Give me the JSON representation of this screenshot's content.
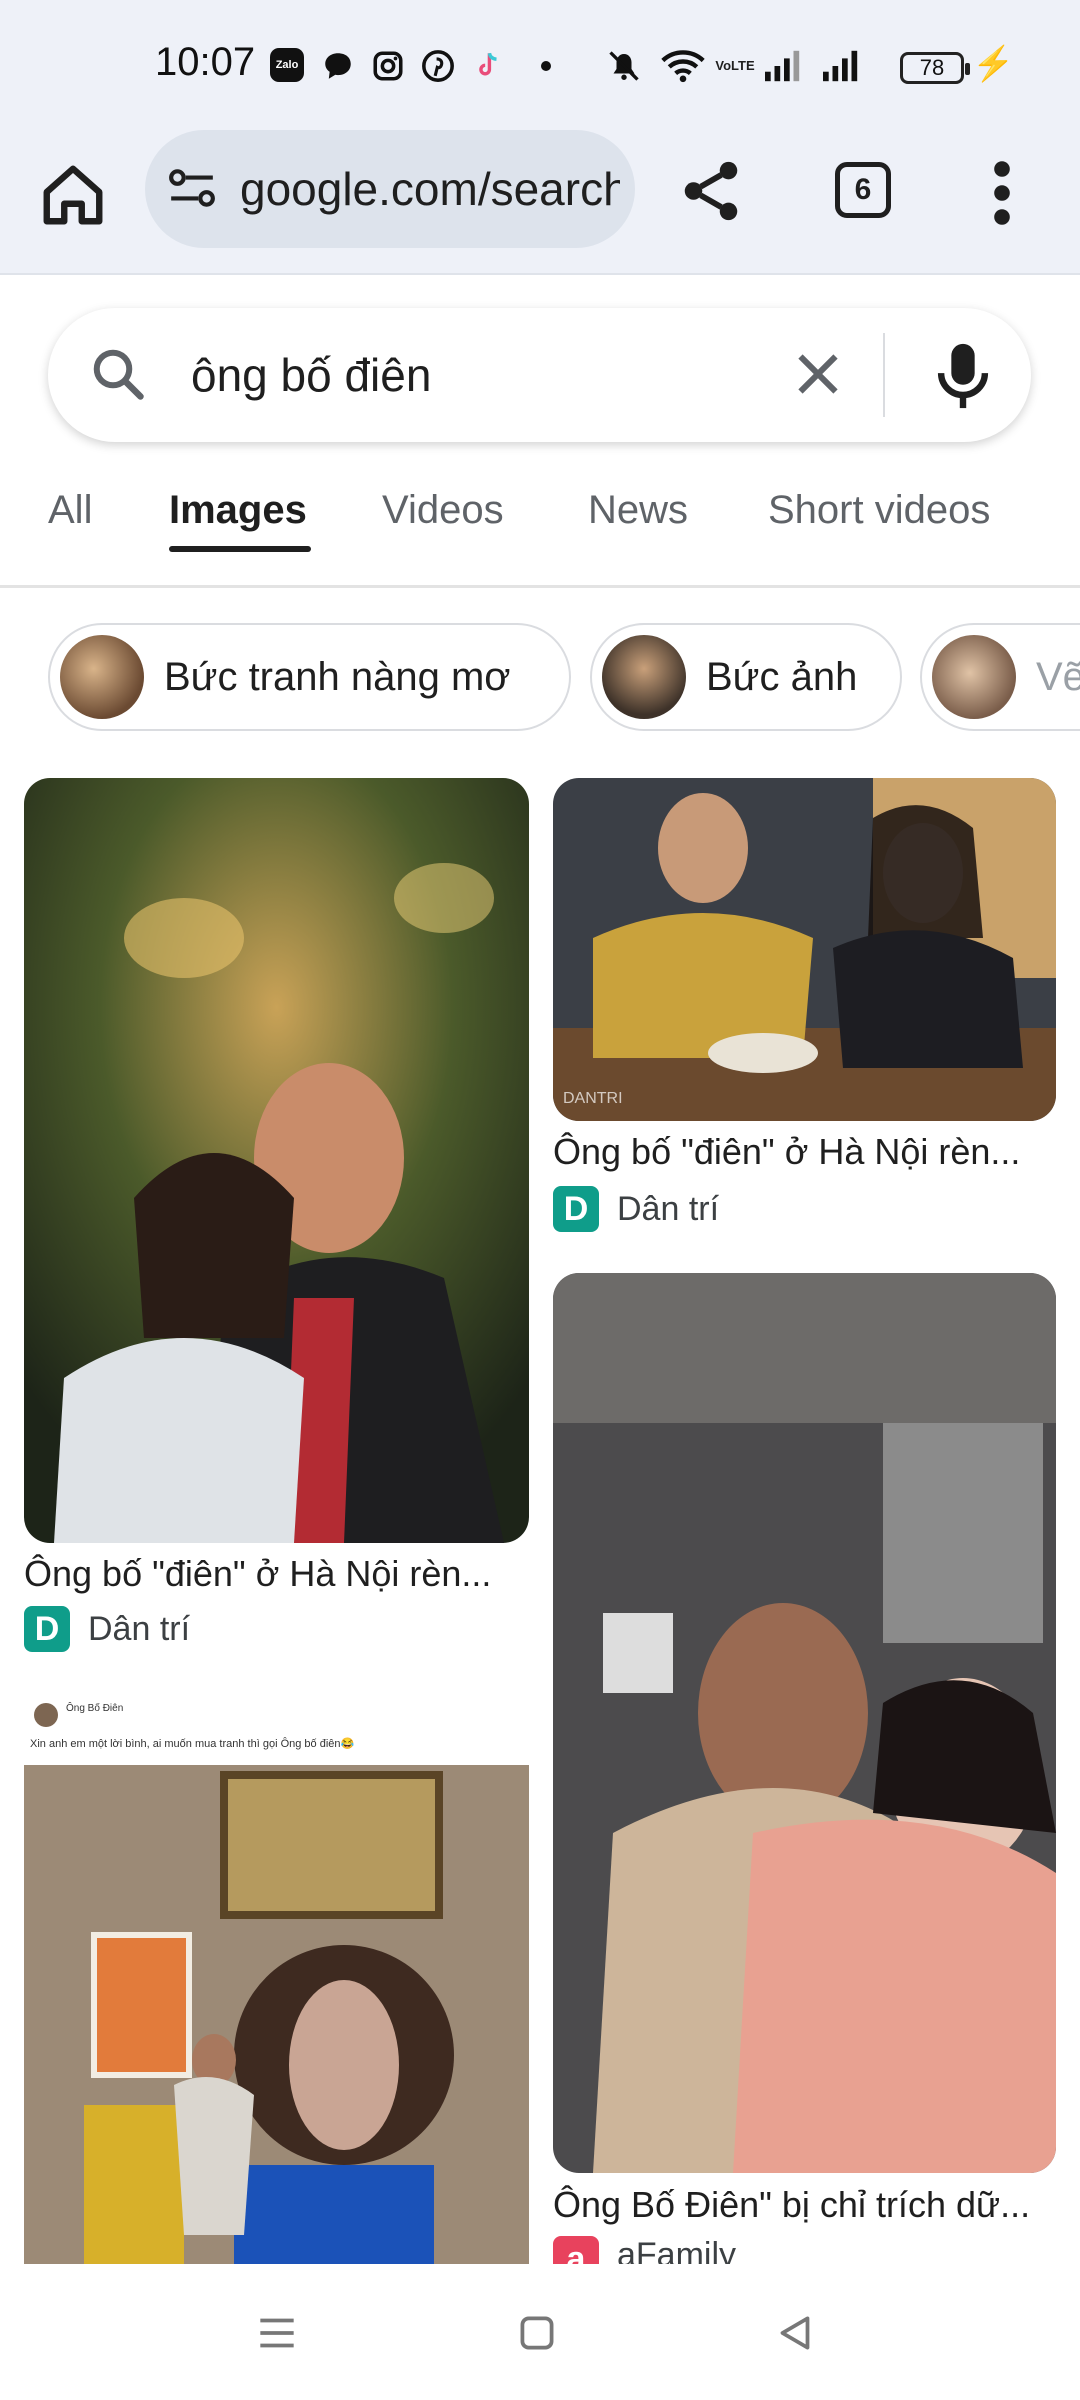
{
  "status_bar": {
    "time": "10:07",
    "app_icons": [
      "zalo-icon",
      "chat-bubble-icon",
      "instagram-icon",
      "pinterest-icon",
      "tiktok-icon"
    ],
    "system_icons": [
      "mute-icon",
      "wifi-icon",
      "volte-icon",
      "signal-icon",
      "signal-icon"
    ],
    "volte_label": "VoLTE",
    "battery_level": "78",
    "zalo_label": "Zalo"
  },
  "browser": {
    "url": "google.com/search",
    "tab_count": "6"
  },
  "search": {
    "query": "ông bố điên"
  },
  "tabs": [
    {
      "label": "All",
      "active": false
    },
    {
      "label": "Images",
      "active": true
    },
    {
      "label": "Videos",
      "active": false
    },
    {
      "label": "News",
      "active": false
    },
    {
      "label": "Short videos",
      "active": false
    }
  ],
  "chips": [
    {
      "label": "Bức tranh nàng mơ"
    },
    {
      "label": "Bức ảnh"
    },
    {
      "label": "Vẽ"
    }
  ],
  "results": [
    {
      "title": "Ông bố \"điên\" ở Hà Nội rèn...",
      "source": "Dân trí",
      "logo": "D",
      "logo_color": "#0f9d8a"
    },
    {
      "title": "Ông bố \"điên\" ở Hà Nội rèn...",
      "source": "Dân trí",
      "logo": "D",
      "logo_color": "#0f9d8a"
    },
    {
      "title": "",
      "source": "",
      "logo": "",
      "logo_color": ""
    },
    {
      "title": "Ông Bố Điên\" bị chỉ trích dữ...",
      "source": "aFamily",
      "logo": "a",
      "logo_color": "#e8425d"
    }
  ],
  "post_image": {
    "author": "Ông Bố Điên",
    "caption": "Xin anh em một lời bình, ai muốn mua tranh thì gọi Ông bố điên😂"
  },
  "watermark": "DANTRI"
}
